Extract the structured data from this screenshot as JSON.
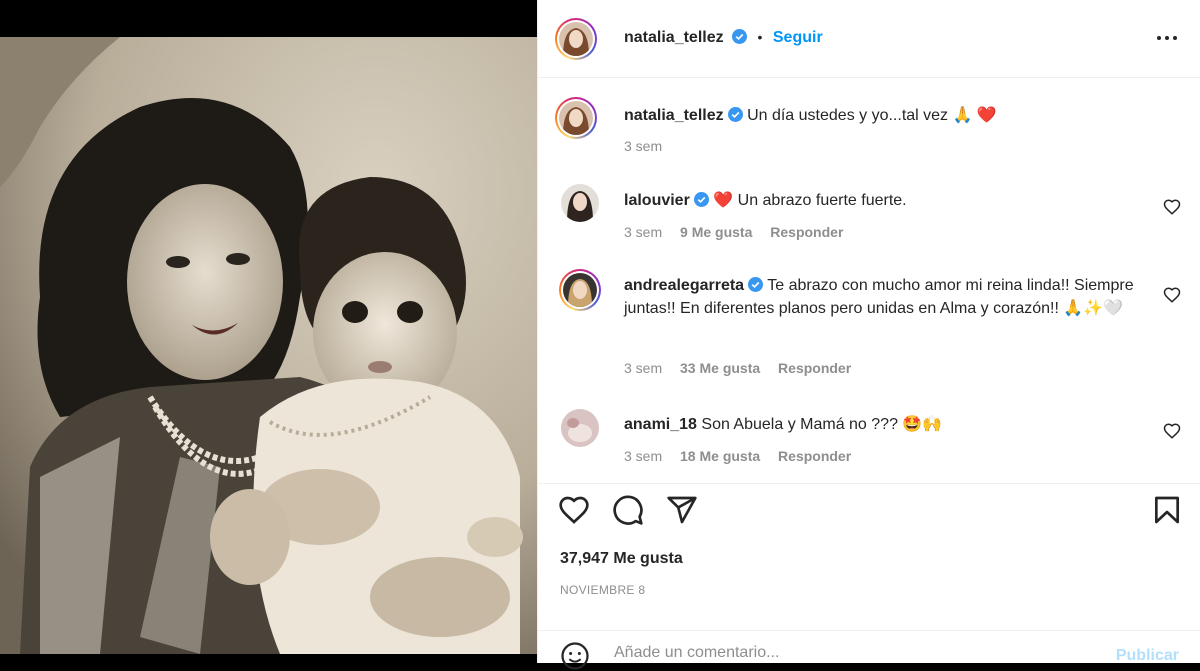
{
  "post": {
    "author": "natalia_tellez",
    "follow_label": "Seguir",
    "separator": "•"
  },
  "caption": {
    "username": "natalia_tellez",
    "text": "Un día ustedes y yo...tal vez 🙏 ❤️",
    "time": "3 sem"
  },
  "comments": [
    {
      "username": "lalouvier",
      "text": "❤️ Un abrazo fuerte fuerte.",
      "time": "3 sem",
      "likes": "9 Me gusta",
      "reply": "Responder"
    },
    {
      "username": "andrealegarreta",
      "text": "Te abrazo con mucho amor mi reina linda!! Siempre juntas!! En diferentes planos pero unidas en Alma y corazón!! 🙏✨🤍",
      "time": "3 sem",
      "likes": "33 Me gusta",
      "reply": "Responder"
    },
    {
      "username": "anami_18",
      "text": "Son Abuela y Mamá no ??? 🤩🙌",
      "time": "3 sem",
      "likes": "18 Me gusta",
      "reply": "Responder"
    }
  ],
  "footer": {
    "likes": "37,947 Me gusta",
    "date": "NOVIEMBRE 8",
    "comment_placeholder": "Añade un comentario...",
    "publish_label": "Publicar"
  },
  "colors": {
    "accent": "#0095f6",
    "verified": "#3897f0",
    "heart": "#ed4956",
    "muted": "#8e8e8e"
  },
  "icons": [
    "more-options-icon",
    "verified-badge-icon",
    "heart-icon",
    "comment-icon",
    "share-icon",
    "bookmark-icon",
    "emoji-icon"
  ]
}
